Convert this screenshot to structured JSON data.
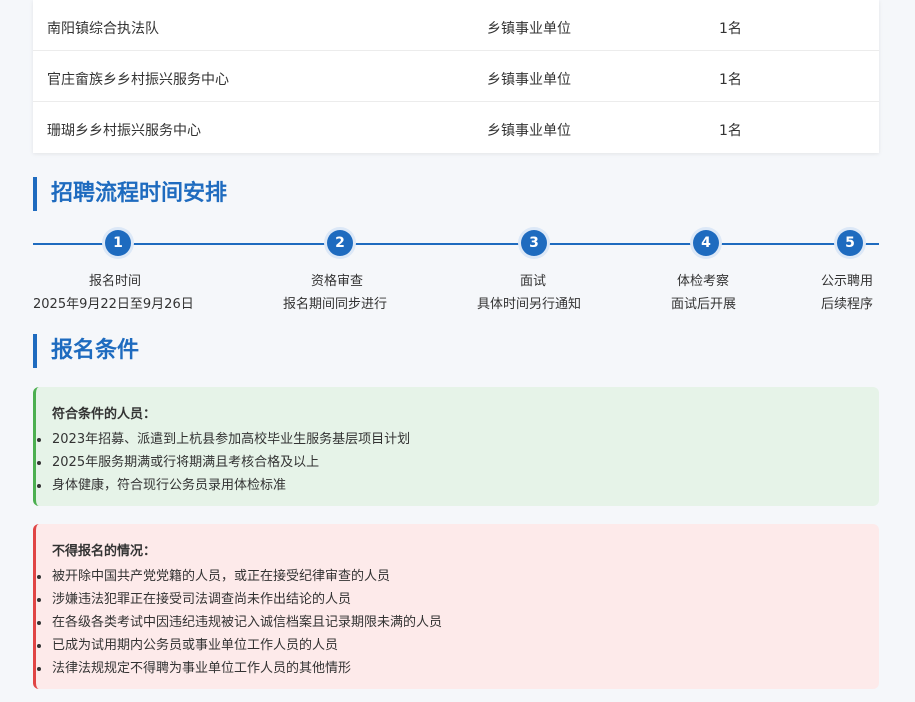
{
  "positions_table": {
    "rows": [
      {
        "name": "南阳镇综合执法队",
        "type": "乡镇事业单位",
        "count": "1名"
      },
      {
        "name": "官庄畲族乡乡村振兴服务中心",
        "type": "乡镇事业单位",
        "count": "1名"
      },
      {
        "name": "珊瑚乡乡村振兴服务中心",
        "type": "乡镇事业单位",
        "count": "1名"
      }
    ]
  },
  "timeline": {
    "title": "招聘流程时间安排",
    "steps": [
      {
        "num": "1",
        "title": "报名时间",
        "desc": "2025年9月22日至9月26日"
      },
      {
        "num": "2",
        "title": "资格审查",
        "desc": "报名期间同步进行"
      },
      {
        "num": "3",
        "title": "面试",
        "desc": "具体时间另行通知"
      },
      {
        "num": "4",
        "title": "体检考察",
        "desc": "面试后开展"
      },
      {
        "num": "5",
        "title": "公示聘用",
        "desc": "后续程序"
      }
    ]
  },
  "conditions": {
    "title": "报名条件",
    "eligible": {
      "title": "符合条件的人员：",
      "items": [
        "2023年招募、派遣到上杭县参加高校毕业生服务基层项目计划",
        "2025年服务期满或行将期满且考核合格及以上",
        "身体健康，符合现行公务员录用体检标准"
      ]
    },
    "ineligible": {
      "title": "不得报名的情况：",
      "items": [
        "被开除中国共产党党籍的人员，或正在接受纪律审查的人员",
        "涉嫌违法犯罪正在接受司法调查尚未作出结论的人员",
        "在各级各类考试中因违纪违规被记入诚信档案且记录期限未满的人员",
        "已成为试用期内公务员或事业单位工作人员的人员",
        "法律法规规定不得聘为事业单位工作人员的其他情形"
      ]
    }
  },
  "colors": {
    "accent": "#1e6bbf",
    "eligible_border": "#4caf50",
    "ineligible_border": "#e04545"
  }
}
